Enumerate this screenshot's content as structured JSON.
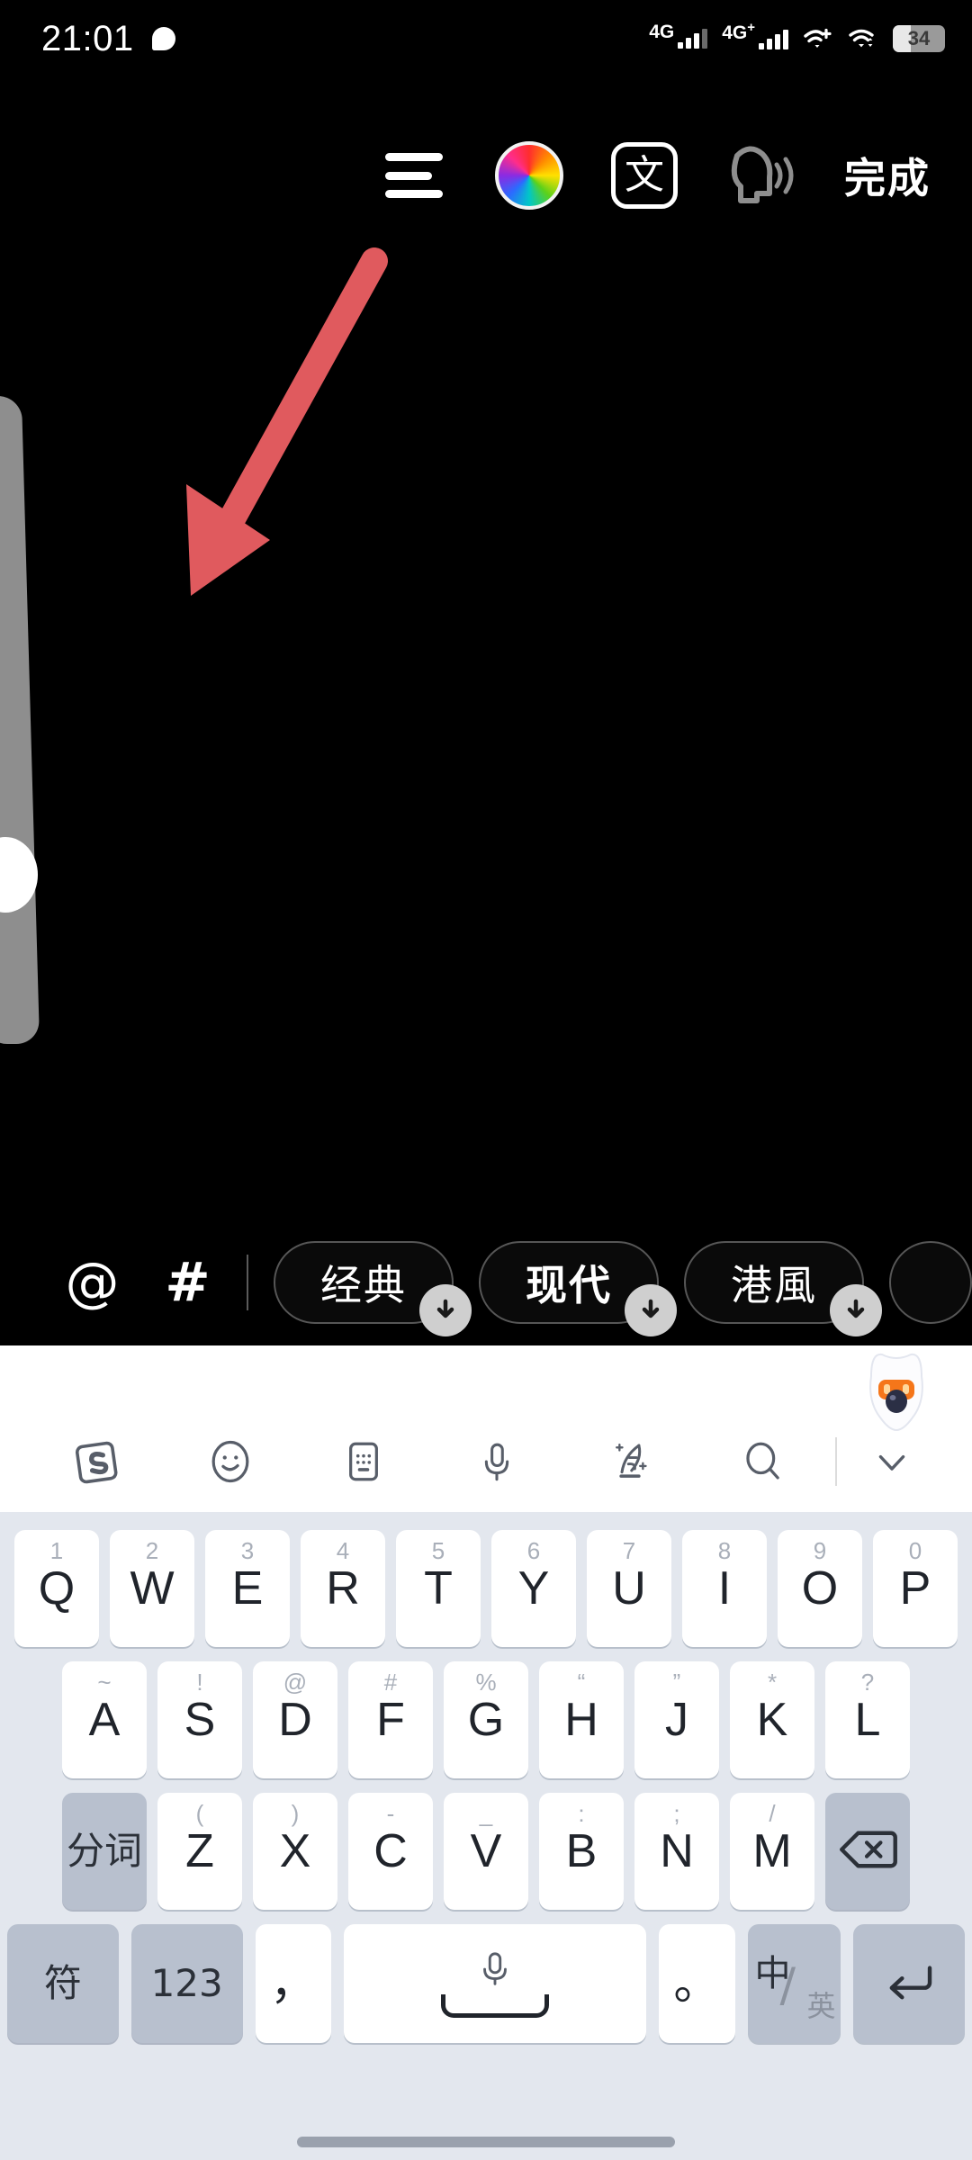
{
  "status_bar": {
    "time": "21:01",
    "bubble_icon": "chat-bubble-icon",
    "network_1": {
      "label": "4G",
      "sup": "",
      "bars": 3
    },
    "network_2": {
      "label": "4G",
      "sup": "+",
      "bars": 4
    },
    "wifi_1": "wifi-plus-icon",
    "wifi_2": "wifi-sync-icon",
    "battery": {
      "percent": "34",
      "level": 34
    }
  },
  "toolbar": {
    "align_icon": "text-align-icon",
    "color_icon": "color-wheel-icon",
    "font_icon": "text-style-icon",
    "font_icon_label": "文",
    "speak_icon": "text-to-speech-icon",
    "done_label": "完成"
  },
  "canvas": {
    "left_panel": "side-drawer-handle",
    "annotation_arrow": "red-arrow-annotation",
    "arrow_color": "#E05A5E"
  },
  "option_bar": {
    "mention_icon": "@",
    "hashtag_icon": "#",
    "chips": [
      {
        "label": "经典",
        "badge": "download-badge",
        "bold": false
      },
      {
        "label": "现代",
        "badge": "download-badge",
        "bold": true
      },
      {
        "label": "港風",
        "badge": "download-badge",
        "bold": false
      },
      {
        "label": "",
        "badge": "download-badge",
        "bold": false,
        "partial": true
      }
    ]
  },
  "keyboard": {
    "mascot": "sogou-mascot-avatar",
    "tools": [
      {
        "name": "sogou-logo-icon"
      },
      {
        "name": "emoji-icon"
      },
      {
        "name": "keyboard-layout-icon"
      },
      {
        "name": "voice-input-icon"
      },
      {
        "name": "handwriting-ai-icon"
      },
      {
        "name": "search-icon"
      },
      {
        "name": "collapse-keyboard-icon"
      }
    ],
    "row1": [
      {
        "main": "Q",
        "sup": "1"
      },
      {
        "main": "W",
        "sup": "2"
      },
      {
        "main": "E",
        "sup": "3"
      },
      {
        "main": "R",
        "sup": "4"
      },
      {
        "main": "T",
        "sup": "5"
      },
      {
        "main": "Y",
        "sup": "6"
      },
      {
        "main": "U",
        "sup": "7"
      },
      {
        "main": "I",
        "sup": "8"
      },
      {
        "main": "O",
        "sup": "9"
      },
      {
        "main": "P",
        "sup": "0"
      }
    ],
    "row2": [
      {
        "main": "A",
        "sup": "~"
      },
      {
        "main": "S",
        "sup": "!"
      },
      {
        "main": "D",
        "sup": "@"
      },
      {
        "main": "F",
        "sup": "#"
      },
      {
        "main": "G",
        "sup": "%"
      },
      {
        "main": "H",
        "sup": "“"
      },
      {
        "main": "J",
        "sup": "”"
      },
      {
        "main": "K",
        "sup": "*"
      },
      {
        "main": "L",
        "sup": "?"
      }
    ],
    "row3_fn_left": "分词",
    "row3": [
      {
        "main": "Z",
        "sup": "("
      },
      {
        "main": "X",
        "sup": ")"
      },
      {
        "main": "C",
        "sup": "-"
      },
      {
        "main": "V",
        "sup": "_"
      },
      {
        "main": "B",
        "sup": ":"
      },
      {
        "main": "N",
        "sup": ";"
      },
      {
        "main": "M",
        "sup": "/"
      }
    ],
    "row3_backspace": "backspace-key",
    "row4": {
      "symbol_label": "符",
      "number_label": "123",
      "comma_label": "，",
      "space_label": "voice-space-key",
      "period_label": "。",
      "cn_label": "中",
      "slash_label": "/",
      "en_label": "英",
      "enter_label": "return-key"
    },
    "home_indicator": "home-indicator"
  }
}
